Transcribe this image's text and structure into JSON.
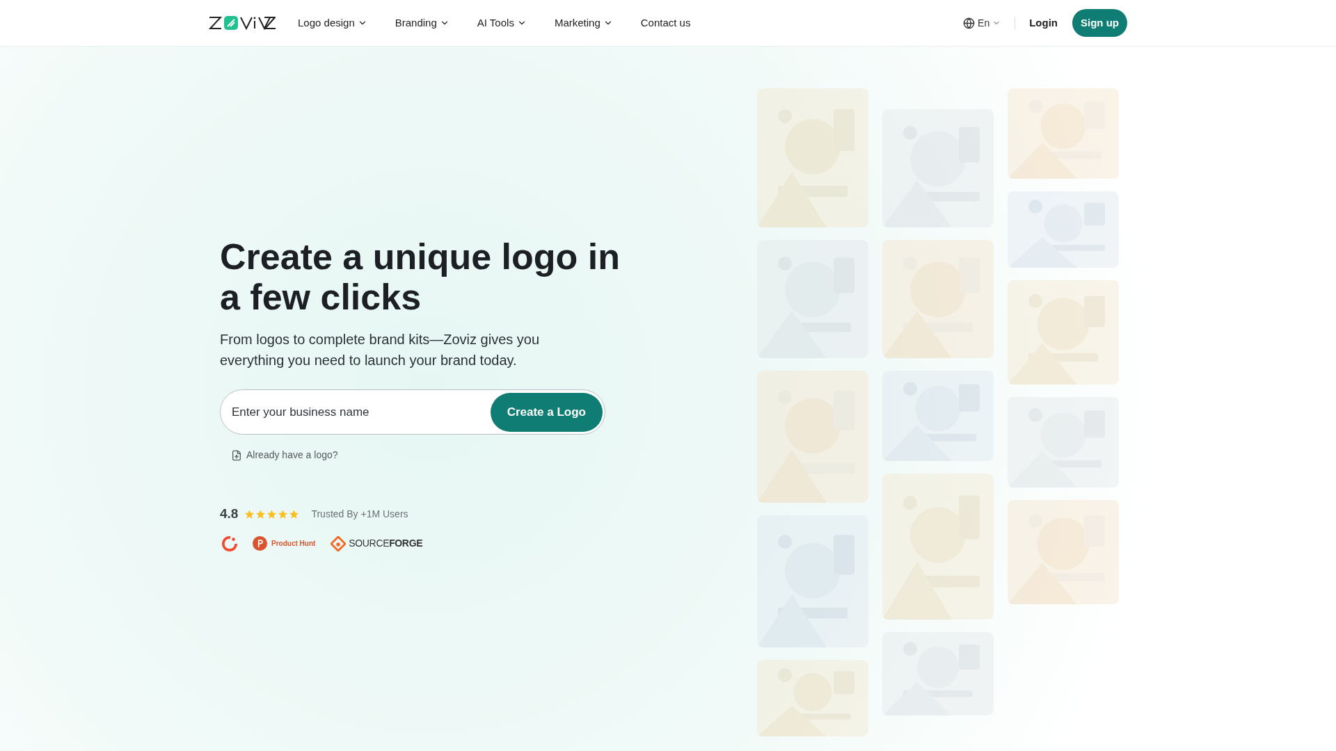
{
  "nav": {
    "items": [
      {
        "label": "Logo design",
        "dropdown": true
      },
      {
        "label": "Branding",
        "dropdown": true
      },
      {
        "label": "AI Tools",
        "dropdown": true
      },
      {
        "label": "Marketing",
        "dropdown": true
      },
      {
        "label": "Contact us",
        "dropdown": false
      }
    ],
    "language": "En",
    "login": "Login",
    "signup": "Sign up"
  },
  "hero": {
    "title": "Create a unique logo in a few clicks",
    "subtitle": "From logos to complete brand kits—Zoviz gives you everything you need to launch your brand today.",
    "input": {
      "placeholder": "Enter your business name"
    },
    "button": "Create a Logo",
    "upload_link": "Already have a logo?",
    "rating": {
      "score": "4.8",
      "stars": 5,
      "caption": "Trusted By +1M Users"
    },
    "badges": [
      {
        "kind": "g2"
      },
      {
        "kind": "producthunt",
        "label": "Product Hunt"
      },
      {
        "kind": "sourceforge",
        "label_light": "SOURCE",
        "label_bold": "FORGE"
      }
    ]
  }
}
